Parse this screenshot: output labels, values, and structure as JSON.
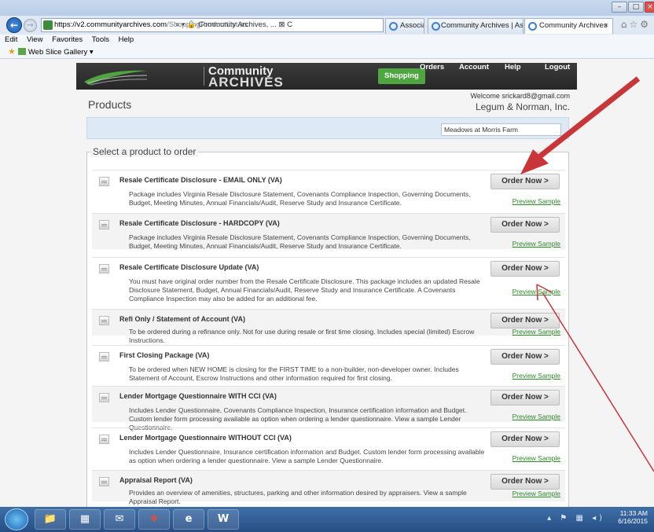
{
  "browser": {
    "url_host": "https://v2.communityarchives.com",
    "url_path": "/ShoppingProductList.as",
    "address_tail": "⌕ ▾ 🔒 Community Archives, ... ⊠ C",
    "tabs": [
      {
        "label": "Associa"
      },
      {
        "label": "Community Archives | As..."
      },
      {
        "label": "Community Archives"
      }
    ],
    "tab_close": "×",
    "menu": [
      "Edit",
      "View",
      "Favorites",
      "Tools",
      "Help"
    ],
    "fav_item": "Web Slice Gallery ▾"
  },
  "site": {
    "logo_line1": "Community",
    "logo_line2": "ARCHIVES",
    "nav": [
      {
        "label": "Shopping",
        "active": true
      },
      {
        "label": "Orders"
      },
      {
        "label": "Account"
      },
      {
        "label": "Help"
      },
      {
        "label": "Logout"
      }
    ],
    "welcome": "Welcome srickard8@gmail.com",
    "page_title": "Products",
    "company": "Legum & Norman, Inc.",
    "community": "Meadows at Morris Farm",
    "section_legend": "Select a product to order"
  },
  "products": [
    {
      "name": "Resale Certificate Disclosure - EMAIL ONLY (VA)",
      "desc": "Package includes Virginia Resale Disclosure Statement, Covenants Compliance Inspection, Governing Documents, Budget, Meeting Minutes, Annual Financials/Audit, Reserve Study and Insurance Certificate.",
      "order": "Order Now >",
      "preview": "Preview Sample"
    },
    {
      "name": "Resale Certificate Disclosure - HARDCOPY (VA)",
      "desc": "Package includes Virginia Resale Disclosure Statement, Covenants Compliance Inspection, Governing Documents, Budget, Meeting Minutes, Annual Financials/Audit, Reserve Study and Insurance Certificate.",
      "order": "Order Now >",
      "preview": "Preview Sample"
    },
    {
      "name": "Resale Certificate Disclosure Update (VA)",
      "desc": "You must have original order number from the Resale Certificate Disclosure. This package includes an updated Resale Disclosure Statement, Budget, Annual Financials/Audit, Reserve Study and Insurance Certificate. A Covenants Compliance Inspection may also be added for an additional fee.",
      "order": "Order Now >",
      "preview": "Preview Sample"
    },
    {
      "name": "Refi Only / Statement of Account (VA)",
      "desc": "To be ordered during a refinance only. Not for use during resale or first time closing. Includes special (limited) Escrow Instructions.",
      "order": "Order Now >",
      "preview": "Preview Sample"
    },
    {
      "name": "First Closing Package (VA)",
      "desc": "To be ordered when NEW HOME is closing for the FIRST TIME to a non-builder, non-developer owner. Includes Statement of Account, Escrow Instructions and other information required for first closing.",
      "order": "Order Now >",
      "preview": "Preview Sample"
    },
    {
      "name": "Lender Mortgage Questionnaire WITH CCI (VA)",
      "desc": "Includes Lender Questionnaire, Covenants Compliance Inspection, Insurance certification information and Budget. Custom lender form processing available as option when ordering a lender questionnaire. View a sample Lender Questionnaire.",
      "order": "Order Now >",
      "preview": "Preview Sample"
    },
    {
      "name": "Lender Mortgage Questionnaire WITHOUT CCI (VA)",
      "desc": "Includes Lender Questionnaire, Insurance certification information and Budget. Custom lender form processing available as option when ordering a lender questionnaire. View a sample Lender Questionnaire.",
      "order": "Order Now >",
      "preview": "Preview Sample"
    },
    {
      "name": "Appraisal Report (VA)",
      "desc": "Provides an overview of amenities, structures, parking and other information desired by appraisers. View a sample Appraisal Report.",
      "order": "Order Now >",
      "preview": "Preview Sample"
    }
  ],
  "taskbar": {
    "time": "11:33 AM",
    "date": "6/16/2015",
    "tray_icons": "▴ ⚑ ▦ ◂)"
  },
  "colors": {
    "accent_green": "#4fa641",
    "annotation_arrow": "#c8363a"
  }
}
